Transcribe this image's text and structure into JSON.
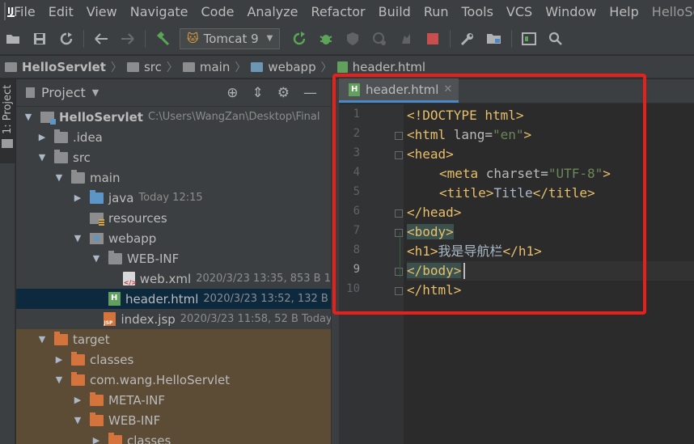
{
  "menubar": {
    "items": [
      "File",
      "Edit",
      "View",
      "Navigate",
      "Code",
      "Analyze",
      "Refactor",
      "Build",
      "Run",
      "Tools",
      "VCS",
      "Window",
      "Help"
    ],
    "window_title": "HelloServl"
  },
  "toolbar": {
    "run_config": "Tomcat 9"
  },
  "breadcrumb": [
    "HelloServlet",
    "src",
    "main",
    "webapp",
    "header.html"
  ],
  "left_stripe": {
    "project_label": "1: Project"
  },
  "project_panel": {
    "title": "Project",
    "tree": [
      {
        "name": "HelloServlet",
        "meta": "C:\\Users\\WangZan\\Desktop\\Final",
        "bold": true
      },
      {
        "name": ".idea",
        "meta": ""
      },
      {
        "name": "src",
        "meta": ""
      },
      {
        "name": "main",
        "meta": ""
      },
      {
        "name": "java",
        "meta": "Today 12:15"
      },
      {
        "name": "resources",
        "meta": ""
      },
      {
        "name": "webapp",
        "meta": ""
      },
      {
        "name": "WEB-INF",
        "meta": ""
      },
      {
        "name": "web.xml",
        "meta": "2020/3/23 13:35, 853 B 1"
      },
      {
        "name": "header.html",
        "meta": "2020/3/23 13:52, 132 B"
      },
      {
        "name": "index.jsp",
        "meta": "2020/3/23 11:58, 52 B Today"
      },
      {
        "name": "target",
        "meta": ""
      },
      {
        "name": "classes",
        "meta": ""
      },
      {
        "name": "com.wang.HelloServlet",
        "meta": ""
      },
      {
        "name": "META-INF",
        "meta": ""
      },
      {
        "name": "WEB-INF",
        "meta": ""
      },
      {
        "name": "classes",
        "meta": ""
      }
    ]
  },
  "editor": {
    "tab_label": "header.html",
    "line_numbers": [
      "1",
      "2",
      "3",
      "4",
      "5",
      "6",
      "7",
      "8",
      "9",
      "10"
    ],
    "code": {
      "l1": "<!DOCTYPE html>",
      "l2_open": "<html ",
      "l2_attr": "lang=",
      "l2_val": "\"en\"",
      "l2_close": ">",
      "l3": "<head>",
      "l4_open": "<meta ",
      "l4_attr": "charset=",
      "l4_val": "\"UTF-8\"",
      "l4_close": ">",
      "l5_open": "<title>",
      "l5_text": "Title",
      "l5_close": "</title>",
      "l6": "</head>",
      "l7": "<body>",
      "l8_open": "<h1>",
      "l8_text": "我是导航栏",
      "l8_close": "</h1>",
      "l9": "</body>",
      "l10": "</html>"
    }
  },
  "colors": {
    "highlight_box": "#e8201c",
    "selection": "#0d293e",
    "excluded_folder": "#5c4c36"
  }
}
